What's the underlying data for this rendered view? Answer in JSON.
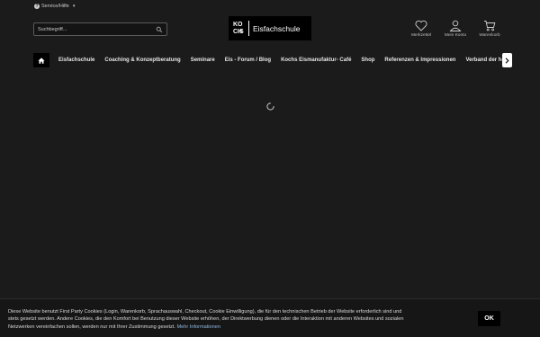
{
  "topbar": {
    "service_label": "Service/Hilfe"
  },
  "search": {
    "placeholder": "Suchbegriff..."
  },
  "logo": {
    "mark": [
      "KO",
      "CH",
      "S"
    ],
    "text": "Eisfachschule"
  },
  "account": {
    "wishlist_label": "Merkzettel",
    "account_label": "Mein Konto",
    "cart_label": "Warenkorb"
  },
  "nav": {
    "items": [
      "Eisfachschule",
      "Coaching & Konzeptberatung",
      "Seminare",
      "Eis - Forum / Blog",
      "Kochs Eismanufaktur- Café",
      "Shop",
      "Referenzen & Impressionen",
      "Verband der ha"
    ]
  },
  "cookie": {
    "text": "Diese Website benutzt First Party Cookies (Login, Warenkorb, Sprachauswahl, Checkout, Cookie Einwilligung), die für den technischen Betrieb der Website erforderlich sind und stets gesetzt werden. Andere Cookies, die den Komfort bei Benutzung dieser Website erhöhen, der Direktwerbung dienen oder die Interaktion mit anderen Websites und sozialen Netzwerken vereinfachen sollen, werden nur mit Ihrer Zustimmung gesetzt.",
    "more_link": "Mehr Informationen",
    "ok_button": "OK"
  }
}
